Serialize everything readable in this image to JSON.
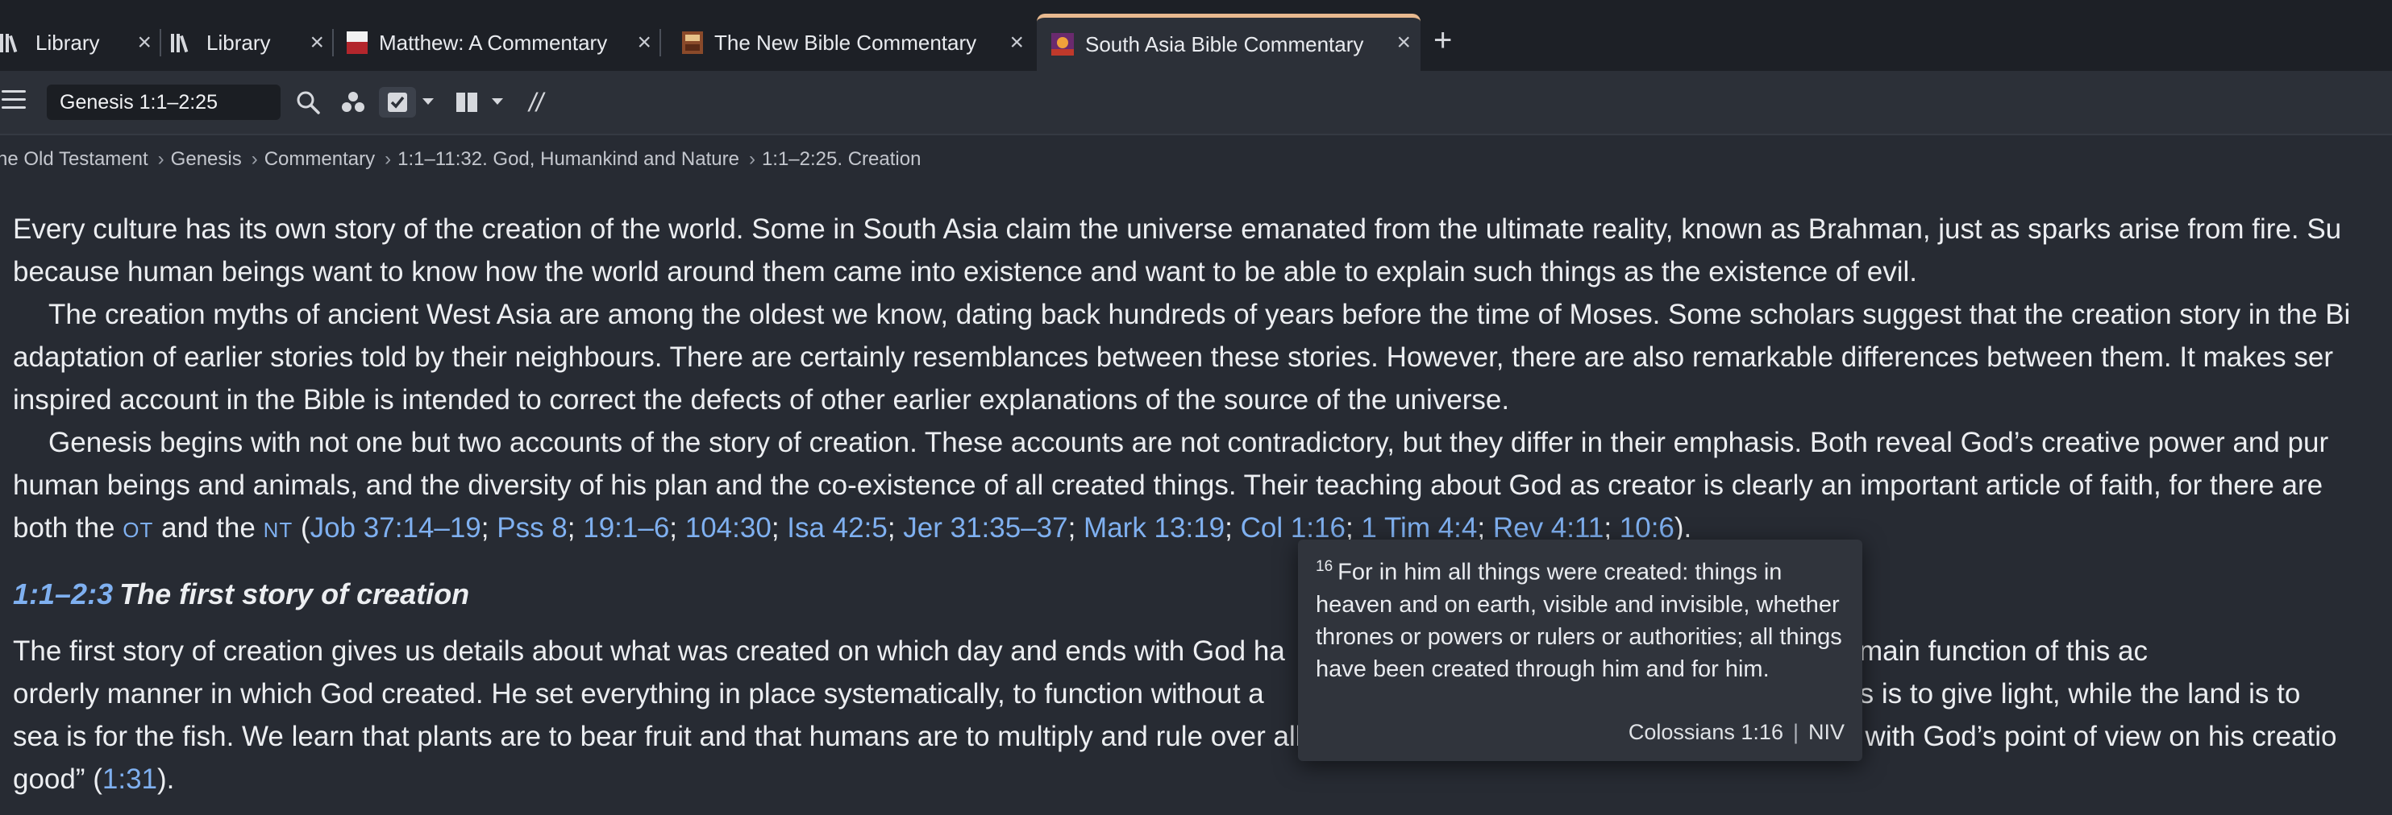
{
  "tabs": [
    {
      "label": "Library",
      "icon": "library-icon",
      "active": false
    },
    {
      "label": "Library",
      "icon": "library-icon",
      "active": false
    },
    {
      "label": "Matthew: A Commentary",
      "icon": "book-cover-icon",
      "active": false
    },
    {
      "label": "The New Bible Commentary",
      "icon": "book-cover-icon",
      "active": false
    },
    {
      "label": "South Asia Bible Commentary",
      "icon": "book-cover-icon",
      "active": true
    }
  ],
  "toolbar": {
    "reference_value": "Genesis 1:1–2:25",
    "reference_placeholder": "Reference",
    "parallel_label": "//"
  },
  "breadcrumb": [
    "he Old Testament",
    "Genesis",
    "Commentary",
    "1:1–11:32. God, Humankind and Nature",
    "1:1–2:25. Creation"
  ],
  "article": {
    "p1_l1": "Every culture has its own story of the creation of the world. Some in South Asia claim the universe emanated from the ultimate reality, known as Brahman, just as sparks arise from fire. Su",
    "p1_l2": "because human beings want to know how the world around them came into existence and want to be able to explain such things as the existence of evil.",
    "p2_l1": "The creation myths of ancient West Asia are among the oldest we know, dating back hundreds of years before the time of Moses. Some scholars suggest that the creation story in the Bi",
    "p2_l2": "adaptation of earlier stories told by their neighbours. There are certainly resemblances between these stories. However, there are also remarkable differences between them. It makes ser",
    "p2_l3": "inspired account in the Bible is intended to correct the defects of other earlier explanations of the source of the universe.",
    "p3_l1": "Genesis begins with not one but two accounts of the story of creation. These accounts are not contradictory, but they differ in their emphasis. Both reveal God’s creative power and pur",
    "p3_l2": "human beings and animals, and the diversity of his plan and the co-existence of all created things. Their teaching about God as creator is clearly an important article of faith, for there are",
    "p3_l3_pre": "both the ",
    "ot": "OT",
    "and_the": " and the ",
    "nt": "NT",
    "refs": [
      "Job 37:14–19",
      "Pss 8",
      "19:1–6",
      "104:30",
      "Isa 42:5",
      "Jer 31:35–37",
      "Mark 13:19",
      "Col 1:16",
      "1 Tim 4:4",
      "Rev 4:11",
      "10:6"
    ],
    "section_ref": "1:1–2:3",
    "section_title": "The first story of creation",
    "p4_l1a": "The first story of creation gives us details about what was created on which day and ends with God ha",
    "p4_l1b": "e seventh day. The main function of this ac",
    "p4_l2a": "orderly manner in which God created. He set everything in place systematically, to function without a",
    "p4_l2b": "y bodies is to give light, while the land is to",
    "p4_l3a": "sea is for the fish. We learn that plants are to bear fruit and that humans are to multiply and rule over all God’s creatures. This story also provides us with God’s point of view on his creatio",
    "p4_l4_pre": "good” (",
    "p4_l4_ref": "1:31",
    "p4_l4_post": ")."
  },
  "popup": {
    "verse_number": "16",
    "verse_text": "For in him all things were created: things in heaven and on earth, visible and invisible, whether thrones or powers or rulers or authorities; all things have been created through him and for him.",
    "reference": "Colossians 1:16",
    "version": "NIV"
  },
  "colors": {
    "background": "#272b33",
    "tabbar": "#1d2026",
    "link": "#7fb0f0",
    "active_tab_accent": "#e8b98f"
  }
}
